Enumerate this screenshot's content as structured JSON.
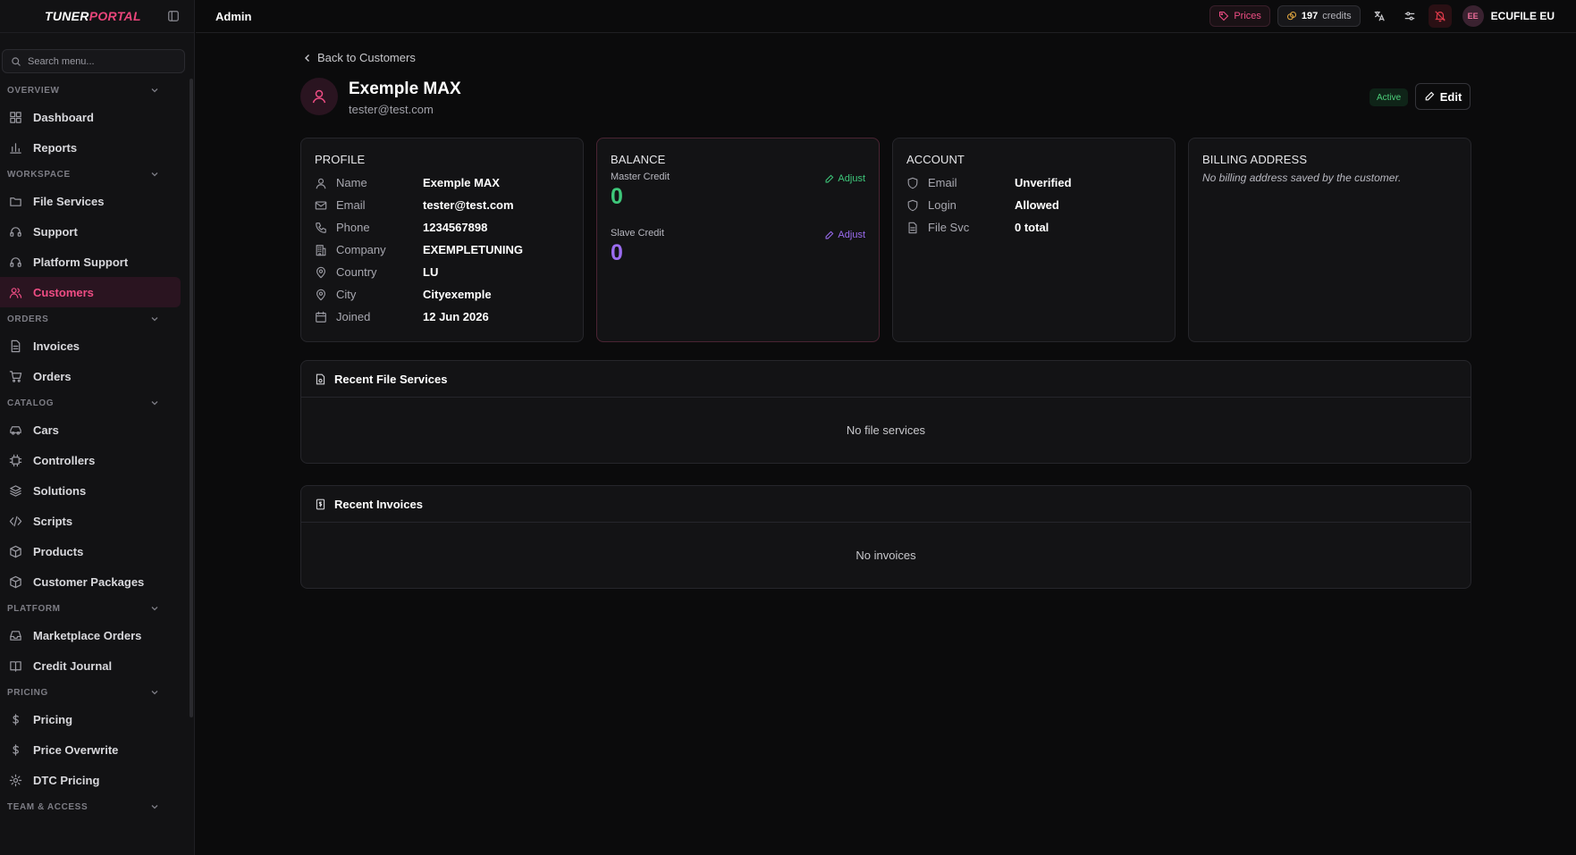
{
  "brand": {
    "logo_main": "TUNER",
    "logo_accent": "PORTAL"
  },
  "sidebar": {
    "search_placeholder": "Search menu...",
    "sections": [
      {
        "label": "OVERVIEW",
        "items": [
          {
            "label": "Dashboard",
            "icon": "grid-icon"
          },
          {
            "label": "Reports",
            "icon": "chart-icon"
          }
        ]
      },
      {
        "label": "WORKSPACE",
        "items": [
          {
            "label": "File Services",
            "icon": "folder-icon"
          },
          {
            "label": "Support",
            "icon": "headset-icon"
          },
          {
            "label": "Platform Support",
            "icon": "headset-icon"
          },
          {
            "label": "Customers",
            "icon": "users-icon",
            "active": true
          }
        ]
      },
      {
        "label": "ORDERS",
        "items": [
          {
            "label": "Invoices",
            "icon": "file-icon"
          },
          {
            "label": "Orders",
            "icon": "cart-icon"
          }
        ]
      },
      {
        "label": "CATALOG",
        "items": [
          {
            "label": "Cars",
            "icon": "car-icon"
          },
          {
            "label": "Controllers",
            "icon": "chip-icon"
          },
          {
            "label": "Solutions",
            "icon": "layers-icon"
          },
          {
            "label": "Scripts",
            "icon": "code-icon"
          },
          {
            "label": "Products",
            "icon": "box-icon"
          },
          {
            "label": "Customer Packages",
            "icon": "box-icon"
          }
        ]
      },
      {
        "label": "PLATFORM",
        "items": [
          {
            "label": "Marketplace Orders",
            "icon": "inbox-icon"
          },
          {
            "label": "Credit Journal",
            "icon": "book-icon"
          }
        ]
      },
      {
        "label": "PRICING",
        "items": [
          {
            "label": "Pricing",
            "icon": "dollar-icon"
          },
          {
            "label": "Price Overwrite",
            "icon": "dollar-icon"
          },
          {
            "label": "DTC Pricing",
            "icon": "gear-icon"
          }
        ]
      },
      {
        "label": "TEAM & ACCESS",
        "items": []
      }
    ]
  },
  "topbar": {
    "title": "Admin",
    "prices_label": "Prices",
    "credits_value": "197",
    "credits_label": "credits",
    "avatar_initials": "EE",
    "username": "ECUFILE EU"
  },
  "customer": {
    "back_label": "Back to Customers",
    "name": "Exemple MAX",
    "email": "tester@test.com",
    "status": "Active",
    "edit_label": "Edit"
  },
  "profile": {
    "title": "PROFILE",
    "rows": [
      {
        "label": "Name",
        "value": "Exemple MAX",
        "icon": "user-icon"
      },
      {
        "label": "Email",
        "value": "tester@test.com",
        "icon": "mail-icon"
      },
      {
        "label": "Phone",
        "value": "1234567898",
        "icon": "phone-icon"
      },
      {
        "label": "Company",
        "value": "EXEMPLETUNING",
        "icon": "building-icon"
      },
      {
        "label": "Country",
        "value": "LU",
        "icon": "pin-icon"
      },
      {
        "label": "City",
        "value": "Cityexemple",
        "icon": "pin-icon"
      },
      {
        "label": "Joined",
        "value": "12 Jun 2026",
        "icon": "calendar-icon"
      }
    ]
  },
  "balance": {
    "title": "BALANCE",
    "master_label": "Master Credit",
    "master_value": "0",
    "slave_label": "Slave Credit",
    "slave_value": "0",
    "adjust_label": "Adjust"
  },
  "account": {
    "title": "ACCOUNT",
    "rows": [
      {
        "label": "Email",
        "value": "Unverified",
        "icon": "shield-icon"
      },
      {
        "label": "Login",
        "value": "Allowed",
        "icon": "shield-icon"
      },
      {
        "label": "File Svc",
        "value": "0 total",
        "icon": "file-icon"
      }
    ]
  },
  "billing": {
    "title": "BILLING ADDRESS",
    "empty_text": "No billing address saved by the customer."
  },
  "recent_files": {
    "title": "Recent File Services",
    "empty_text": "No file services"
  },
  "recent_invoices": {
    "title": "Recent Invoices",
    "empty_text": "No invoices"
  },
  "colors": {
    "accent": "#ee4d84",
    "green": "#3ec77a",
    "purple": "#9b6cf0"
  }
}
